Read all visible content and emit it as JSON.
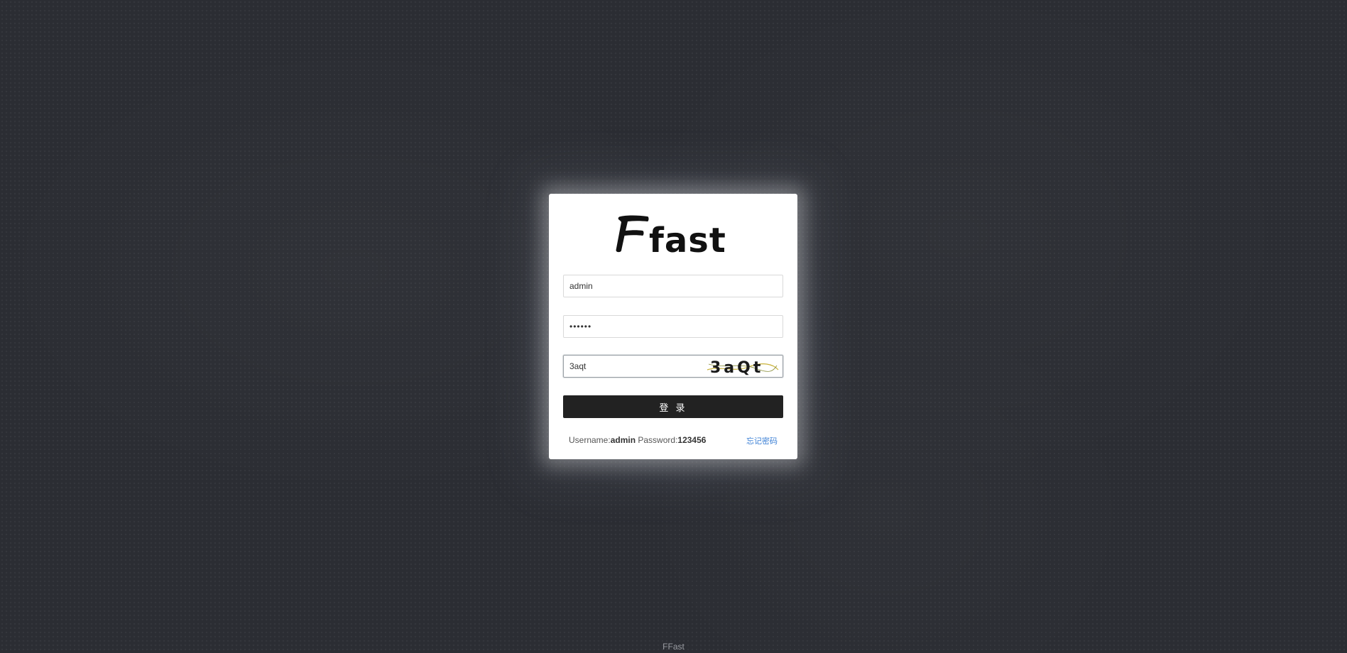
{
  "logo": {
    "text": "Ffast",
    "icon": "ffast-logo"
  },
  "form": {
    "username_value": "admin",
    "password_value": "••••••",
    "captcha_value": "3aqt",
    "captcha_image_text": "3aQt",
    "submit_label": "登 录"
  },
  "hint": {
    "username_label": "Username:",
    "username": "admin",
    "password_label": "Password:",
    "password": "123456"
  },
  "forgot_label": "忘记密码",
  "footer": "FFast",
  "colors": {
    "background": "#2b2d33",
    "card": "#ffffff",
    "button": "#222222",
    "link": "#3a7fd5"
  }
}
